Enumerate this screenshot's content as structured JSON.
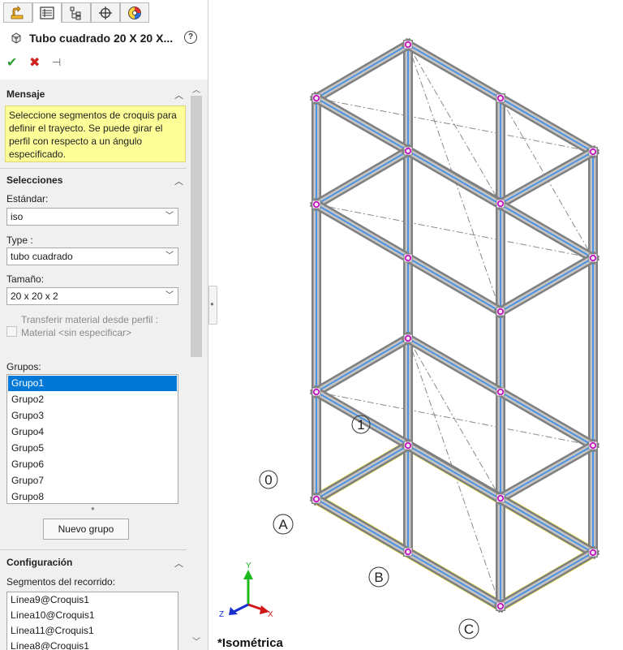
{
  "tabs": [
    {
      "name": "featuremanager-tab",
      "icon": "featuremanager-icon"
    },
    {
      "name": "propertymanager-tab",
      "icon": "propertymanager-icon"
    },
    {
      "name": "configurationmanager-tab",
      "icon": "configurationmanager-icon"
    },
    {
      "name": "dimxpert-tab",
      "icon": "crosshair-icon"
    },
    {
      "name": "display-manager-tab",
      "icon": "appearance-icon"
    }
  ],
  "feature": {
    "title": "Tubo cuadrado 20 X 20 X...",
    "help": "?"
  },
  "actions": {
    "ok": "✔",
    "cancel": "✖",
    "pin": "⊣"
  },
  "mensaje": {
    "title": "Mensaje",
    "text": "Seleccione segmentos de croquis para definir el trayecto. Se puede girar el perfil con respecto a un ángulo especificado."
  },
  "selecciones": {
    "title": "Selecciones",
    "estandar_label": "Estándar:",
    "estandar_value": "iso",
    "type_label": "Type :",
    "type_value": "tubo cuadrado",
    "tamano_label": "Tamaño:",
    "tamano_value": "20 x 20 x 2",
    "transfer_label": "Transferir material desde perfil : Material <sin especificar>",
    "grupos_label": "Grupos:",
    "grupos": [
      "Grupo1",
      "Grupo2",
      "Grupo3",
      "Grupo4",
      "Grupo5",
      "Grupo6",
      "Grupo7",
      "Grupo8"
    ],
    "selected_group": "Grupo1",
    "nuevo_grupo": "Nuevo grupo"
  },
  "configuracion": {
    "title": "Configuración",
    "segmentos_label": "Segmentos del recorrido:",
    "segmentos": [
      "Línea9@Croquis1",
      "Línea10@Croquis1",
      "Línea11@Croquis1",
      "Línea8@Croquis1"
    ]
  },
  "viewport": {
    "view_name": "*Isométrica",
    "callouts": [
      "0",
      "1",
      "A",
      "B",
      "C"
    ],
    "triad": {
      "x": "X",
      "y": "Y",
      "z": "Z"
    }
  },
  "colors": {
    "selection_yellow": "#f5ee1e",
    "path_blue": "#3f8fe8",
    "tube_gray": "#9a9a9a",
    "vertex_magenta": "#c000c0",
    "list_highlight": "#0078d7",
    "message_bg": "#ffff99"
  }
}
